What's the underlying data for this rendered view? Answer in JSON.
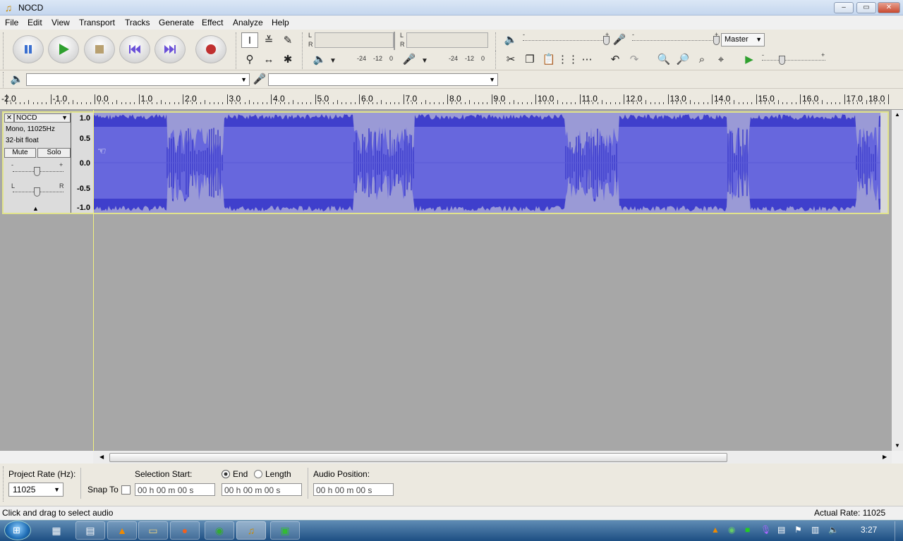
{
  "window": {
    "title": "NOCD",
    "controls": {
      "minimize": "‒",
      "maximize": "▭",
      "close": "✕"
    }
  },
  "menu": [
    "File",
    "Edit",
    "View",
    "Transport",
    "Tracks",
    "Generate",
    "Effect",
    "Analyze",
    "Help"
  ],
  "transport": {
    "buttons": [
      "pause",
      "play",
      "stop",
      "skip-start",
      "skip-end",
      "record"
    ]
  },
  "meters": {
    "play_L": "L",
    "play_R": "R",
    "rec_L": "L",
    "rec_R": "R",
    "scale1": [
      "-24",
      "-12",
      "0"
    ],
    "scale2": [
      "-24",
      "-12",
      "0"
    ]
  },
  "mixer": {
    "out_minus": "-",
    "out_plus": "+",
    "in_minus": "-",
    "in_plus": "+",
    "input_source": "Master",
    "speed_minus": "-",
    "speed_plus": "+"
  },
  "ruler": {
    "labels": [
      "-2.0",
      "-1.0",
      "0.0",
      "1.0",
      "2.0",
      "3.0",
      "4.0",
      "5.0",
      "6.0",
      "7.0",
      "8.0",
      "9.0",
      "10.0",
      "11.0",
      "12.0",
      "13.0",
      "14.0",
      "15.0",
      "16.0",
      "17.0",
      "18.0"
    ]
  },
  "track": {
    "name": "NOCD",
    "close": "✕",
    "info1": "Mono, 11025Hz",
    "info2": "32-bit float",
    "mute": "Mute",
    "solo": "Solo",
    "gain_minus": "-",
    "gain_plus": "+",
    "pan_left": "L",
    "pan_right": "R",
    "scale": [
      "1.0",
      "0.5",
      "0.0",
      "-0.5",
      "-1.0"
    ]
  },
  "bottom": {
    "project_rate_label": "Project Rate (Hz):",
    "project_rate": "11025",
    "snap_to": "Snap To",
    "selection_start_label": "Selection Start:",
    "end_label": "End",
    "length_label": "Length",
    "audio_position_label": "Audio Position:",
    "time_value": "00 h 00 m 00 s"
  },
  "status": {
    "left": "Click and drag to select audio",
    "right": "Actual Rate: 11025"
  },
  "taskbar": {
    "clock": "3:27"
  },
  "colors": {
    "wave_dark": "#3f3fcc",
    "wave_light": "#6767dd",
    "wave_peak": "#9a9ad6",
    "track_border": "#e1e38c"
  }
}
